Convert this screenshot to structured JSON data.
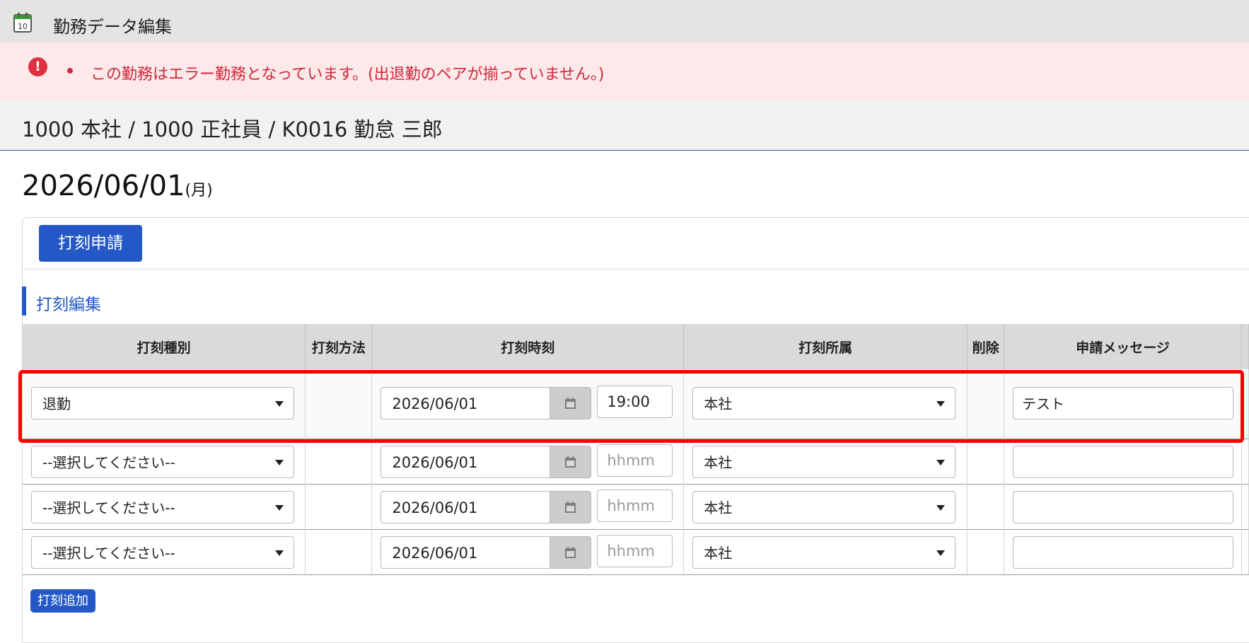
{
  "header": {
    "title": "勤務データ編集",
    "icon": "calendar-icon"
  },
  "alert": {
    "icon": "error-icon",
    "message": "この勤務はエラー勤務となっています。(出退勤のペアが揃っていません。)",
    "color": "#d0283a"
  },
  "employee": {
    "info": "1000 本社 / 1000 正社員 / K0016 勤怠 三郎"
  },
  "date": {
    "value": "2026/06/01",
    "weekday": "(月)"
  },
  "toolbar": {
    "apply_label": "打刻申請"
  },
  "section": {
    "title": "打刻編集"
  },
  "table": {
    "columns": [
      "打刻種別",
      "打刻方法",
      "打刻時刻",
      "打刻所属",
      "削除",
      "申請メッセージ"
    ],
    "rows": [
      {
        "type": "退勤",
        "method": "",
        "date": "2026/06/01",
        "time": "19:00",
        "time_placeholder": "hhmm",
        "affiliation": "本社",
        "message": "テスト"
      },
      {
        "type": "--選択してください--",
        "method": "",
        "date": "2026/06/01",
        "time": "",
        "time_placeholder": "hhmm",
        "affiliation": "本社",
        "message": ""
      },
      {
        "type": "--選択してください--",
        "method": "",
        "date": "2026/06/01",
        "time": "",
        "time_placeholder": "hhmm",
        "affiliation": "本社",
        "message": ""
      },
      {
        "type": "--選択してください--",
        "method": "",
        "date": "2026/06/01",
        "time": "",
        "time_placeholder": "hhmm",
        "affiliation": "本社",
        "message": ""
      }
    ]
  },
  "add_label": "打刻追加",
  "colors": {
    "accent": "#2458c6",
    "highlight": "#ff0000"
  }
}
